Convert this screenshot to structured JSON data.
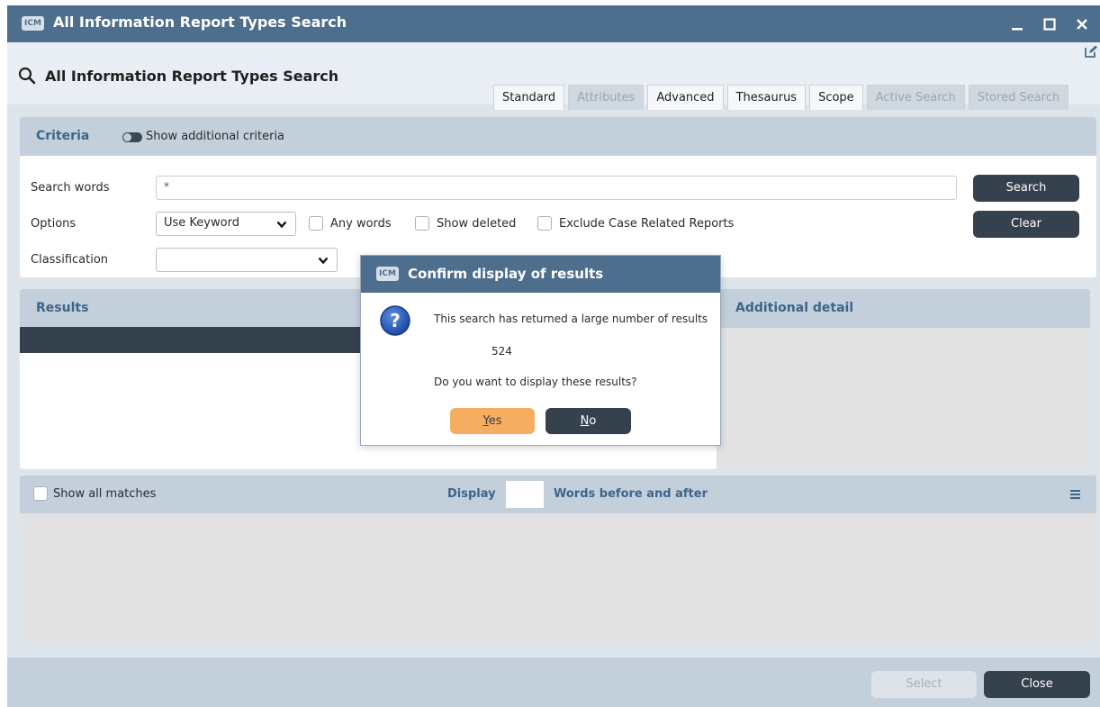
{
  "window": {
    "title": "All Information Report Types Search",
    "app_badge": "ICM"
  },
  "header": {
    "page_title": "All Information Report Types Search"
  },
  "tabs": [
    {
      "label": "Standard",
      "enabled": true
    },
    {
      "label": "Attributes",
      "enabled": false
    },
    {
      "label": "Advanced",
      "enabled": true
    },
    {
      "label": "Thesaurus",
      "enabled": true
    },
    {
      "label": "Scope",
      "enabled": true
    },
    {
      "label": "Active Search",
      "enabled": false
    },
    {
      "label": "Stored Search",
      "enabled": false
    }
  ],
  "criteria": {
    "title": "Criteria",
    "toggle_label": "Show additional criteria",
    "search_words_label": "Search words",
    "search_words_value": "*",
    "options_label": "Options",
    "options_selected": "Use Keyword",
    "any_words_label": "Any words",
    "show_deleted_label": "Show deleted",
    "exclude_case_label": "Exclude Case Related Reports",
    "classification_label": "Classification",
    "classification_selected": "",
    "search_button": "Search",
    "clear_button": "Clear"
  },
  "results": {
    "title": "Results",
    "additional_detail_title": "Additional detail"
  },
  "matches": {
    "show_all_label": "Show all matches",
    "display_label": "Display",
    "words_label": "Words before and after"
  },
  "footer": {
    "select_button": "Select",
    "close_button": "Close"
  },
  "dialog": {
    "badge": "ICM",
    "title": "Confirm display of results",
    "message": "This search has returned a large number of results",
    "count": "524",
    "question": "Do you want to display these results?",
    "yes_mnemonic": "Y",
    "yes_rest": "es",
    "no_mnemonic": "N",
    "no_rest": "o"
  },
  "colors": {
    "titlebar": "#4d6e8c",
    "panel_header": "#c3d0dc",
    "dark_button": "#36414e",
    "accent_yes": "#f5ad62",
    "heading_text": "#3d6489"
  }
}
